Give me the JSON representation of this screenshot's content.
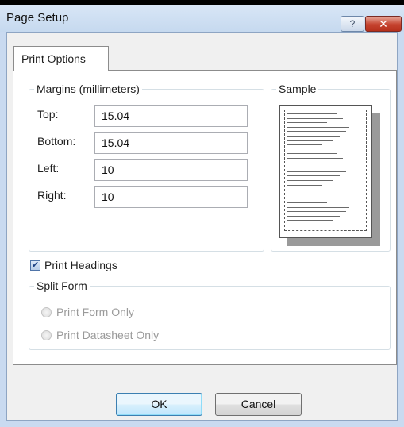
{
  "window": {
    "title": "Page Setup",
    "help_glyph": "?",
    "close_glyph": "✕"
  },
  "tabs": [
    {
      "label": "Print Options"
    }
  ],
  "margins": {
    "group_label": "Margins (millimeters)",
    "top_label": "Top:",
    "top_value": "15.04",
    "bottom_label": "Bottom:",
    "bottom_value": "15.04",
    "left_label": "Left:",
    "left_value": "10",
    "right_label": "Right:",
    "right_value": "10"
  },
  "sample": {
    "group_label": "Sample"
  },
  "print_headings": {
    "label": "Print Headings",
    "checked": true,
    "check_glyph": "✔"
  },
  "split_form": {
    "group_label": "Split Form",
    "options": [
      {
        "label": "Print Form Only",
        "enabled": false
      },
      {
        "label": "Print Datasheet Only",
        "enabled": false
      }
    ]
  },
  "buttons": {
    "ok": "OK",
    "cancel": "Cancel"
  }
}
